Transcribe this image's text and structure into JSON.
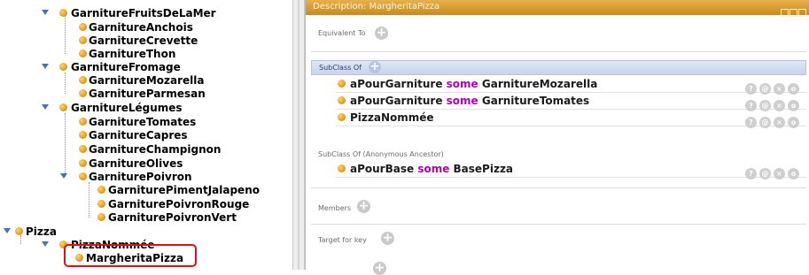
{
  "tree": {
    "nodes": [
      {
        "label": "GarnitureFruitsDeLaMer"
      },
      {
        "label": "GarnitureAnchois"
      },
      {
        "label": "GarnitureCrevette"
      },
      {
        "label": "GarnitureThon"
      },
      {
        "label": "GarnitureFromage"
      },
      {
        "label": "GarnitureMozarella"
      },
      {
        "label": "GarnitureParmesan"
      },
      {
        "label": "GarnitureLégumes"
      },
      {
        "label": "GarnitureTomates"
      },
      {
        "label": "GarnitureCapres"
      },
      {
        "label": "GarnitureChampignon"
      },
      {
        "label": "GarnitureOlives"
      },
      {
        "label": "GarniturePoivron"
      },
      {
        "label": "GarniturePimentJalapeno"
      },
      {
        "label": "GarniturePoivronRouge"
      },
      {
        "label": "GarniturePoivronVert"
      },
      {
        "label": "Pizza"
      },
      {
        "label": "PizzaNommée"
      },
      {
        "label": "MargheritaPizza"
      }
    ]
  },
  "panel": {
    "title": "Description: MargheritaPizza",
    "equivalent_to": "Equivalent To",
    "subclass_of": "SubClass Of",
    "axioms": [
      {
        "prop": "aPourGarniture",
        "kw": "some",
        "cls": "GarnitureMozarella"
      },
      {
        "prop": "aPourGarniture",
        "kw": "some",
        "cls": "GarnitureTomates"
      },
      {
        "prop": "PizzaNommée",
        "kw": "",
        "cls": ""
      }
    ],
    "anon_ancestor": "SubClass Of (Anonymous Ancestor)",
    "anon_axioms": [
      {
        "prop": "aPourBase",
        "kw": "some",
        "cls": "BasePizza"
      }
    ],
    "members": "Members",
    "target_for_key": "Target for key",
    "add_symbol": "+",
    "row_icons": [
      "?",
      "@",
      "×",
      "o"
    ]
  },
  "colors": {
    "accent": "#e0a020",
    "title_bar": "#d49a2c",
    "keyword": "#b000b0",
    "selection": "#e01010"
  }
}
